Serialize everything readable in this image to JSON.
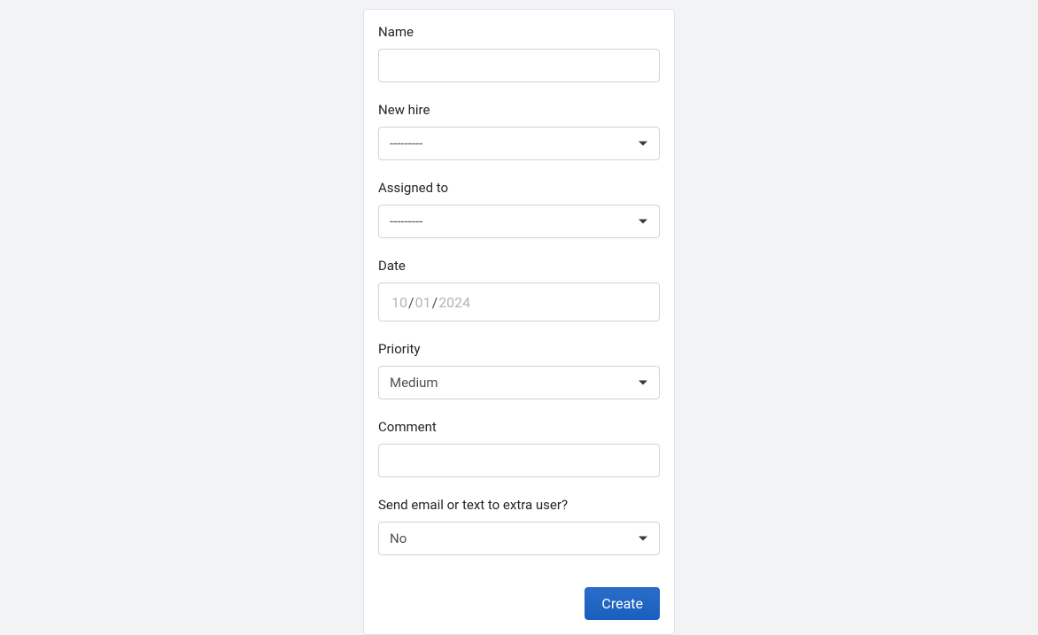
{
  "form": {
    "name": {
      "label": "Name",
      "value": ""
    },
    "new_hire": {
      "label": "New hire",
      "selected": "---------"
    },
    "assigned_to": {
      "label": "Assigned to",
      "selected": "---------"
    },
    "date": {
      "label": "Date",
      "month": "10",
      "day": "01",
      "year": "2024"
    },
    "priority": {
      "label": "Priority",
      "selected": "Medium"
    },
    "comment": {
      "label": "Comment",
      "value": ""
    },
    "send_extra": {
      "label": "Send email or text to extra user?",
      "selected": "No"
    },
    "submit_label": "Create"
  }
}
